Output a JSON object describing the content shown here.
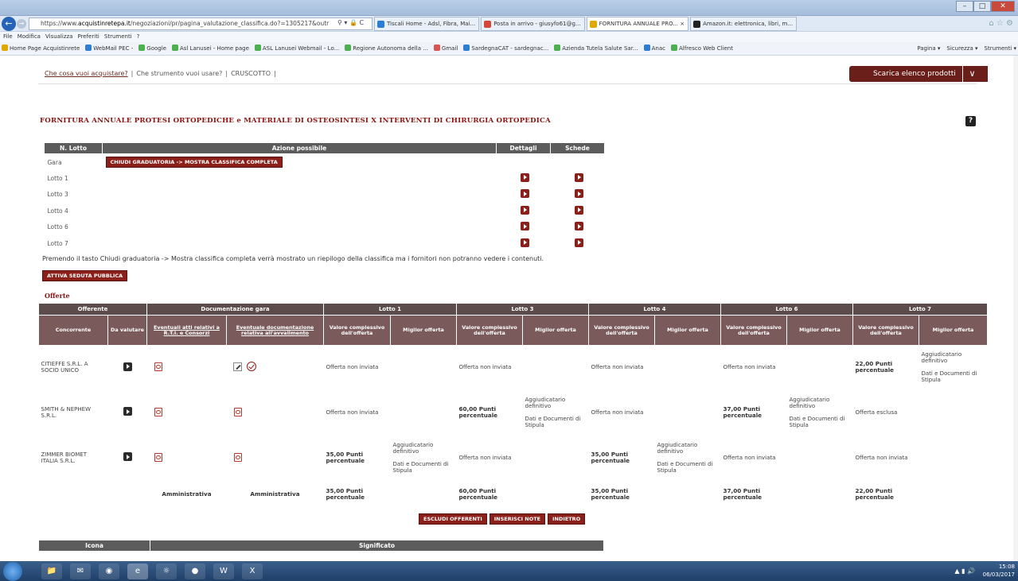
{
  "browser": {
    "url_prefix": "https://www.",
    "url_domain": "acquistinretepa.it",
    "url_rest": "/negoziazioni/pr/pagina_valutazione_classifica.do?=1305217&outr",
    "tabs": [
      {
        "label": "Tiscali Home - Adsl, Fibra, Mai...",
        "color": "#2a7fd4"
      },
      {
        "label": "Posta in arrivo - giusyfo61@g...",
        "color": "#d44638"
      },
      {
        "label": "FORNITURA ANNUALE PRO...  ×",
        "color": "#e0a800",
        "active": true
      },
      {
        "label": "Amazon.it: elettronica, libri, m...",
        "color": "#222"
      }
    ],
    "menu": [
      "File",
      "Modifica",
      "Visualizza",
      "Preferiti",
      "Strumenti",
      "?"
    ],
    "favorites": [
      {
        "label": "Home Page Acquistinrete",
        "c": "y"
      },
      {
        "label": "WebMail PEC -",
        "c": ""
      },
      {
        "label": "Google",
        "c": "g"
      },
      {
        "label": "Asl Lanusei - Home page",
        "c": "g"
      },
      {
        "label": "ASL Lanusei Webmail - Lo...",
        "c": "g"
      },
      {
        "label": "Regione Autonoma della ...",
        "c": "g"
      },
      {
        "label": "Gmail",
        "c": "r"
      },
      {
        "label": "SardegnaCAT - sardegnac...",
        "c": ""
      },
      {
        "label": "Azienda Tutela Salute Sar...",
        "c": "g"
      },
      {
        "label": "Anac",
        "c": ""
      },
      {
        "label": "Alfresco Web Client",
        "c": "g"
      }
    ],
    "fav_right": [
      "Pagina ▾",
      "Sicurezza ▾",
      "Strumenti ▾"
    ]
  },
  "nav": {
    "link1": "Che cosa vuoi acquistare?",
    "link2": "Che strumento vuoi usare?",
    "link3": "CRUSCOTTO",
    "download": "Scarica elenco prodotti"
  },
  "title": "FORNITURA ANNUALE PROTESI ORTOPEDICHE e MATERIALE DI OSTEOSINTESI X INTERVENTI DI CHIRURGIA ORTOPEDICA",
  "lots_table": {
    "headers": [
      "N. Lotto",
      "Azione possibile",
      "Dettagli",
      "Schede"
    ],
    "gara_label": "Gara",
    "gara_button": "CHIUDI GRADUATORIA -> MOSTRA CLASSIFICA COMPLETA",
    "rows": [
      "Lotto 1",
      "Lotto 3",
      "Lotto 4",
      "Lotto 6",
      "Lotto 7"
    ]
  },
  "note": "Premendo il tasto Chiudi graduatoria -> Mostra classifica completa verrà mostrato un riepilogo della classifica ma i fornitori non potranno vedere i contenuti.",
  "attiva_button": "ATTIVA SEDUTA PUBBLICA",
  "offerte_label": "Offerte",
  "offers": {
    "groups": [
      "Offerente",
      "Documentazione gara",
      "Lotto 1",
      "Lotto 3",
      "Lotto 4",
      "Lotto 6",
      "Lotto 7"
    ],
    "sub": {
      "concorrente": "Concorrente",
      "da_valutare": "Da valutare",
      "doc1": "Eventuali atti relativi a R.T.I. e Consorzi",
      "doc2": "Eventuale documentazione relativa all'avvalimento",
      "valore": "Valore complessivo dell'offerta",
      "migliore": "Miglior offerta"
    },
    "rows": [
      {
        "name": "CITIEFFE S.R.L. A SOCIO UNICO",
        "l1_val": "Offerta non inviata",
        "l1_best": "",
        "l3_val": "Offerta non inviata",
        "l3_best": "",
        "l4_val": "Offerta non inviata",
        "l4_best": "",
        "l6_val": "Offerta non inviata",
        "l6_best": "",
        "l7_val": "22,00 Punti percentuale",
        "l7_best1": "Aggiudicatario definitivo",
        "l7_best2": "Dati e Documenti di Stipula"
      },
      {
        "name": "SMITH & NEPHEW S.R.L.",
        "l1_val": "Offerta non inviata",
        "l1_best": "",
        "l3_val": "60,00 Punti percentuale",
        "l3_best1": "Aggiudicatario definitivo",
        "l3_best2": "Dati e Documenti di Stipula",
        "l4_val": "Offerta non inviata",
        "l4_best": "",
        "l6_val": "37,00 Punti percentuale",
        "l6_best1": "Aggiudicatario definitivo",
        "l6_best2": "Dati e Documenti di Stipula",
        "l7_val": "Offerta esclusa",
        "l7_best": ""
      },
      {
        "name": "ZIMMER BIOMET ITALIA S.R.L.",
        "l1_val": "35,00 Punti percentuale",
        "l1_best1": "Aggiudicatario definitivo",
        "l1_best2": "Dati e Documenti di Stipula",
        "l3_val": "Offerta non inviata",
        "l3_best": "",
        "l4_val": "35,00 Punti percentuale",
        "l4_best1": "Aggiudicatario definitivo",
        "l4_best2": "Dati e Documenti di Stipula",
        "l6_val": "Offerta non inviata",
        "l6_best": "",
        "l7_val": "Offerta non inviata",
        "l7_best": ""
      }
    ],
    "footer": {
      "doc1": "Amministrativa",
      "doc2": "Amministrativa",
      "l1": "35,00 Punti percentuale",
      "l3": "60,00 Punti percentuale",
      "l4": "35,00 Punti percentuale",
      "l6": "37,00 Punti percentuale",
      "l7": "22,00 Punti percentuale"
    }
  },
  "actions": [
    "ESCLUDI OFFERENTI",
    "INSERISCI NOTE",
    "INDIETRO"
  ],
  "legend": {
    "icona": "Icona",
    "significato": "Significato"
  },
  "taskbar": {
    "time": "15:08",
    "date": "06/03/2017"
  },
  "colors": {
    "accent": "#8b1f1a",
    "header_bg": "#5c5c5c",
    "title_red": "#8b1510"
  }
}
